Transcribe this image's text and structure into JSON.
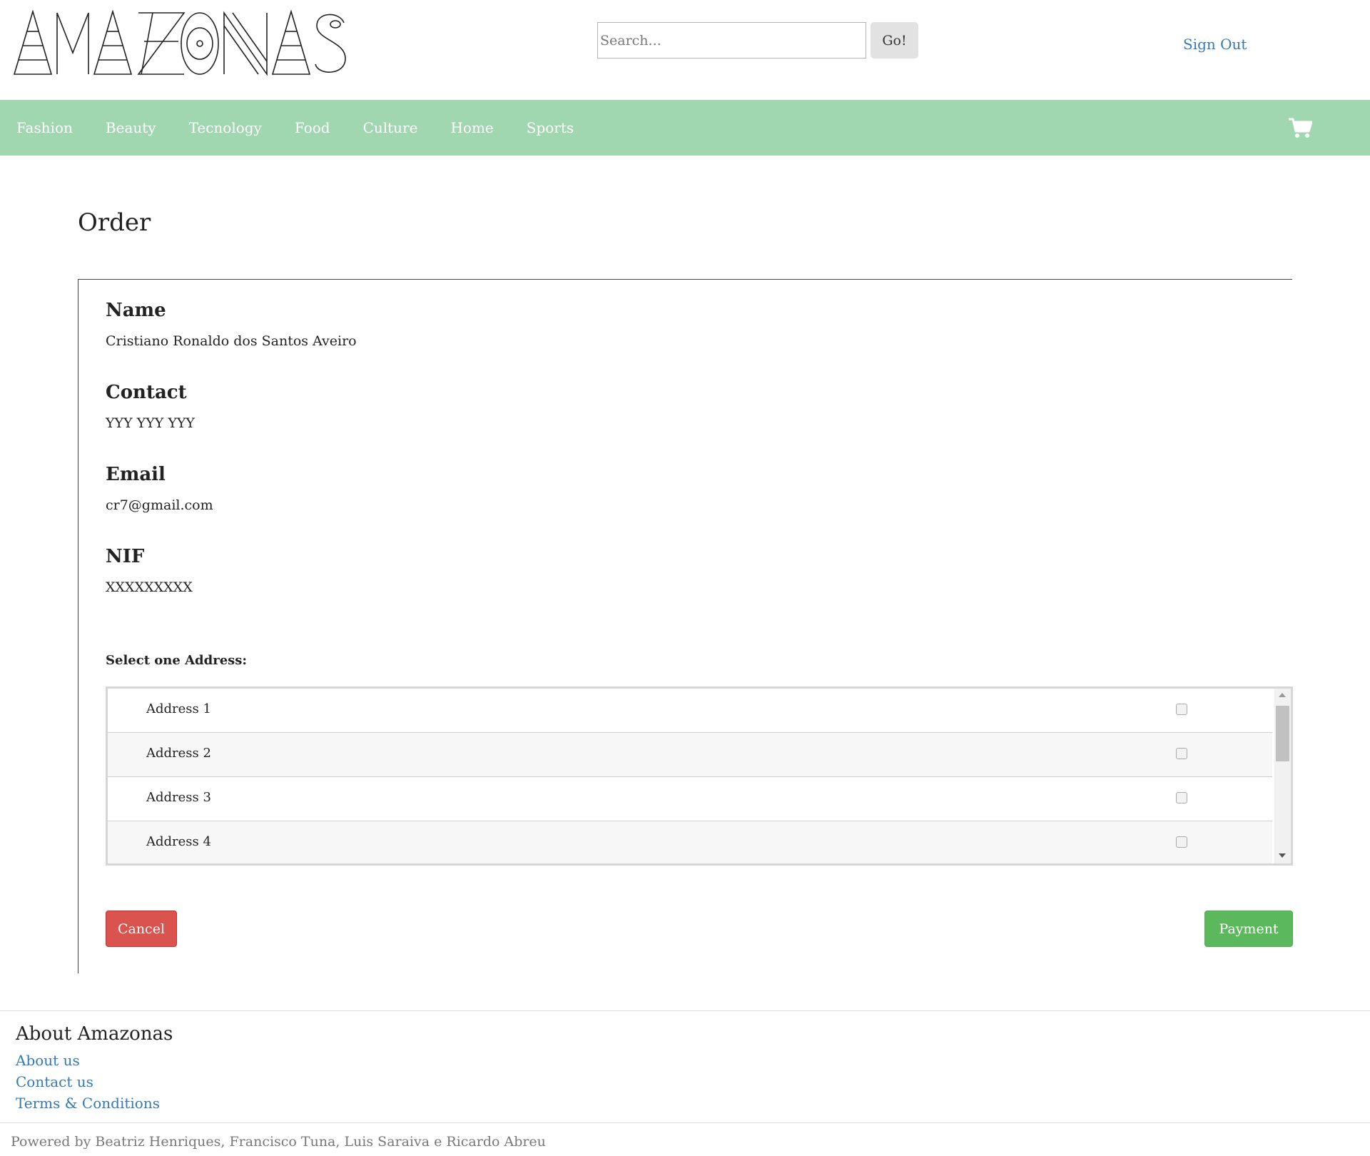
{
  "brand": {
    "logo_text": "AMAZONAS"
  },
  "header": {
    "search_placeholder": "Search...",
    "go_label": "Go!",
    "signout_label": "Sign Out"
  },
  "nav": {
    "items": [
      "Fashion",
      "Beauty",
      "Tecnology",
      "Food",
      "Culture",
      "Home",
      "Sports"
    ],
    "cart_icon": "shopping-cart-icon"
  },
  "order": {
    "title": "Order",
    "name_label": "Name",
    "name_value": "Cristiano Ronaldo dos Santos Aveiro",
    "contact_label": "Contact",
    "contact_value": "YYY YYY YYY",
    "email_label": "Email",
    "email_value": "cr7@gmail.com",
    "nif_label": "NIF",
    "nif_value": "XXXXXXXXX",
    "select_address_label": "Select one Address:",
    "addresses": [
      {
        "name": "Address 1",
        "checked": false
      },
      {
        "name": "Address 2",
        "checked": false
      },
      {
        "name": "Address 3",
        "checked": false
      },
      {
        "name": "Address 4",
        "checked": false
      }
    ],
    "cancel_label": "Cancel",
    "payment_label": "Payment"
  },
  "footer": {
    "title": "About Amazonas",
    "links": [
      "About us",
      "Contact us",
      "Terms & Conditions"
    ],
    "credits": "Powered by Beatriz Henriques, Francisco Tuna, Luis Saraiva e Ricardo Abreu"
  },
  "colors": {
    "nav_bg": "#a0d6b0",
    "link": "#337ab7",
    "cancel": "#d9534f",
    "payment": "#5cb85c"
  }
}
